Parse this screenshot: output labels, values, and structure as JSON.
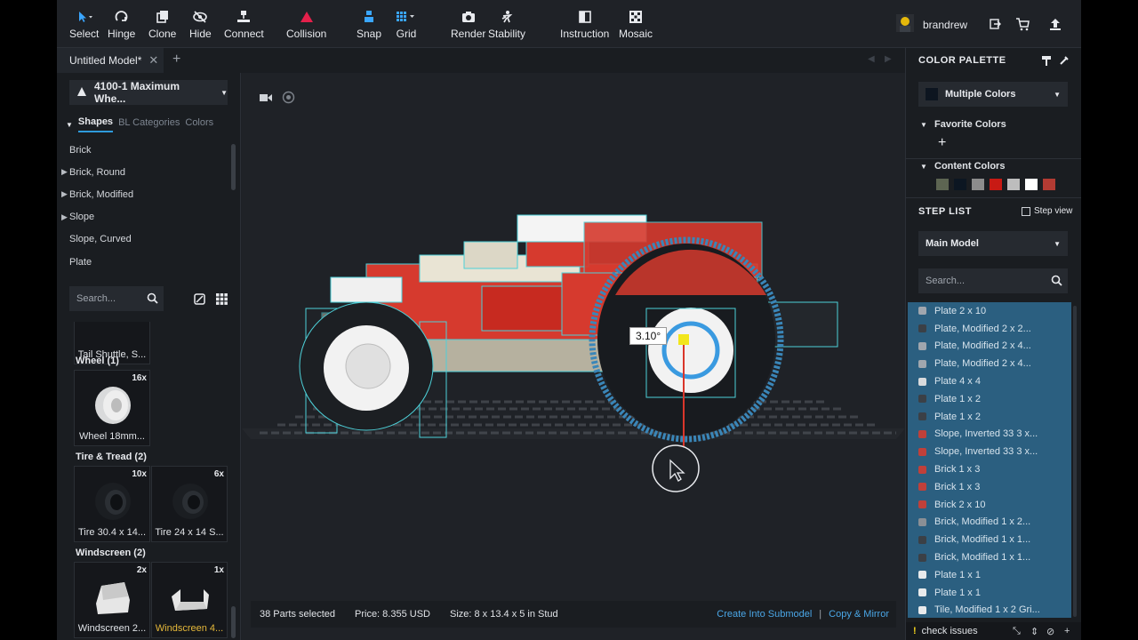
{
  "toolbar": {
    "tools": [
      {
        "id": "select",
        "label": "Select",
        "icon": "cursor-icon"
      },
      {
        "id": "hinge",
        "label": "Hinge",
        "icon": "rotate-icon"
      },
      {
        "id": "clone",
        "label": "Clone",
        "icon": "clone-icon"
      },
      {
        "id": "hide",
        "label": "Hide",
        "icon": "eye-off-icon"
      },
      {
        "id": "connect",
        "label": "Connect",
        "icon": "connect-icon"
      },
      {
        "id": "collision",
        "label": "Collision",
        "icon": "warning-triangle-icon"
      },
      {
        "id": "snap",
        "label": "Snap",
        "icon": "snap-icon"
      },
      {
        "id": "grid",
        "label": "Grid",
        "icon": "grid-icon"
      },
      {
        "id": "render",
        "label": "Render",
        "icon": "camera-icon"
      },
      {
        "id": "stability",
        "label": "Stability",
        "icon": "stability-icon"
      },
      {
        "id": "instruction",
        "label": "Instruction",
        "icon": "book-icon"
      },
      {
        "id": "mosaic",
        "label": "Mosaic",
        "icon": "mosaic-icon"
      }
    ],
    "username": "brandrew"
  },
  "tabs": {
    "model_tab": "Untitled Model*"
  },
  "left": {
    "set_selector": "4100-1 Maximum Whe...",
    "tabs": [
      "Shapes",
      "BL Categories",
      "Colors"
    ],
    "categories": [
      {
        "label": "Brick",
        "expandable": false
      },
      {
        "label": "Brick, Round",
        "expandable": true
      },
      {
        "label": "Brick, Modified",
        "expandable": true
      },
      {
        "label": "Slope",
        "expandable": true
      },
      {
        "label": "Slope, Curved",
        "expandable": false
      },
      {
        "label": "Plate",
        "expandable": false
      }
    ],
    "search_placeholder": "Search...",
    "parts": {
      "top_partial": "Tail Shuttle, S...",
      "wheel_group": "Wheel (1)",
      "wheel": {
        "count": "16x",
        "name": "Wheel 18mm..."
      },
      "tire_group": "Tire & Tread (2)",
      "tire1": {
        "count": "10x",
        "name": "Tire 30.4 x 14..."
      },
      "tire2": {
        "count": "6x",
        "name": "Tire 24 x 14 S..."
      },
      "windscreen_group": "Windscreen (2)",
      "ws1": {
        "count": "2x",
        "name": "Windscreen 2..."
      },
      "ws2": {
        "count": "1x",
        "name": "Windscreen 4..."
      }
    }
  },
  "viewport": {
    "angle_label": "3.10°"
  },
  "status": {
    "selected": "38 Parts selected",
    "price": "Price: 8.355 USD",
    "size": "Size: 8 x 13.4 x 5 in Stud",
    "submodel": "Create Into Submodel",
    "separator": "|",
    "copy_mirror": "Copy & Mirror"
  },
  "right": {
    "palette_title": "COLOR PALETTE",
    "color_select": "Multiple Colors",
    "favorite": "Favorite Colors",
    "content": "Content Colors",
    "content_colors": [
      "#5d6552",
      "#0c1622",
      "#8c8c8c",
      "#c81a14",
      "#bdbdbd",
      "#ffffff",
      "#b23b33"
    ],
    "steplist_title": "STEP LIST",
    "step_view": "Step view",
    "model_select": "Main Model",
    "search_placeholder": "Search...",
    "steps": [
      {
        "name": "Plate 2 x 10",
        "color": "#a0a6ae"
      },
      {
        "name": "Plate, Modified 2 x 2...",
        "color": "#3b4046"
      },
      {
        "name": "Plate, Modified 2 x 4...",
        "color": "#a0a6ae"
      },
      {
        "name": "Plate, Modified 2 x 4...",
        "color": "#a0a6ae"
      },
      {
        "name": "Plate 4 x 4",
        "color": "#d8dadc"
      },
      {
        "name": "Plate 1 x 2",
        "color": "#3b4046"
      },
      {
        "name": "Plate 1 x 2",
        "color": "#3b4046"
      },
      {
        "name": "Slope, Inverted 33 3 x...",
        "color": "#c0403a"
      },
      {
        "name": "Slope, Inverted 33 3 x...",
        "color": "#c0403a"
      },
      {
        "name": "Brick 1 x 3",
        "color": "#c0403a"
      },
      {
        "name": "Brick 1 x 3",
        "color": "#c0403a"
      },
      {
        "name": "Brick 2 x 10",
        "color": "#c0403a"
      },
      {
        "name": "Brick, Modified 1 x 2...",
        "color": "#8a8f95"
      },
      {
        "name": "Brick, Modified 1 x 1...",
        "color": "#3b4046"
      },
      {
        "name": "Brick, Modified 1 x 1...",
        "color": "#3b4046"
      },
      {
        "name": "Plate 1 x 1",
        "color": "#e8eaec"
      },
      {
        "name": "Plate 1 x 1",
        "color": "#e8eaec"
      },
      {
        "name": "Tile, Modified 1 x 2 Gri...",
        "color": "#e8eaec"
      }
    ],
    "check_issues": "check issues"
  }
}
